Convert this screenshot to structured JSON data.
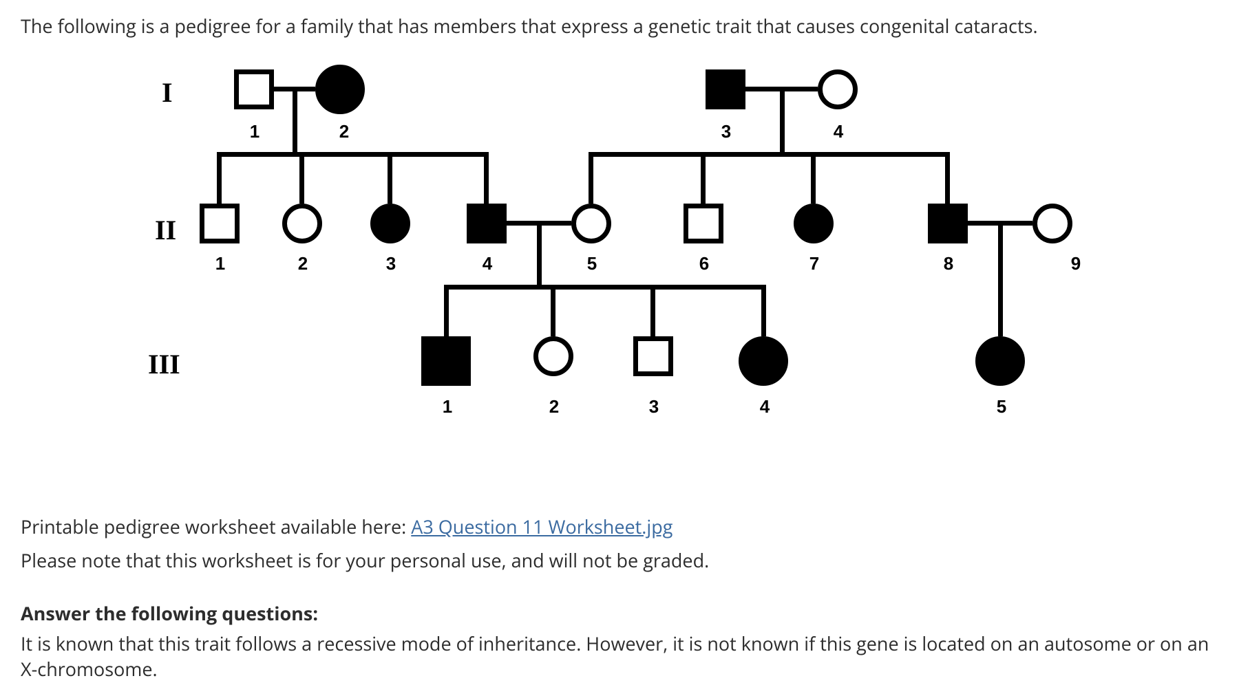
{
  "intro": "The following is a pedigree for a family that has members that express a genetic trait that causes congenital cataracts.",
  "generations": {
    "g1_label": "I",
    "g2_label": "II",
    "g3_label": "III"
  },
  "numbers": {
    "n1": "1",
    "n2": "2",
    "n3": "3",
    "n4": "4",
    "n5": "5",
    "n6": "6",
    "n7": "7",
    "n8": "8",
    "n9": "9"
  },
  "footer": {
    "printable_prefix": "Printable pedigree worksheet available here: ",
    "link_text": "A3 Question 11 Worksheet.jpg",
    "note": "Please note that this worksheet is for your personal use, and will not be graded.",
    "heading": "Answer the following questions:",
    "body": "It is known that this trait follows a recessive mode of inheritance. However, it is not known if this gene is located on an autosome or on an X-chromosome."
  },
  "pedigree": {
    "gen1": [
      {
        "id": "I-1",
        "sex": "male",
        "affected": false
      },
      {
        "id": "I-2",
        "sex": "female",
        "affected": true
      },
      {
        "id": "I-3",
        "sex": "male",
        "affected": true
      },
      {
        "id": "I-4",
        "sex": "female",
        "affected": false
      }
    ],
    "gen2": [
      {
        "id": "II-1",
        "sex": "male",
        "affected": false
      },
      {
        "id": "II-2",
        "sex": "female",
        "affected": false
      },
      {
        "id": "II-3",
        "sex": "female",
        "affected": true
      },
      {
        "id": "II-4",
        "sex": "male",
        "affected": true
      },
      {
        "id": "II-5",
        "sex": "female",
        "affected": false
      },
      {
        "id": "II-6",
        "sex": "male",
        "affected": false
      },
      {
        "id": "II-7",
        "sex": "female",
        "affected": true
      },
      {
        "id": "II-8",
        "sex": "male",
        "affected": true
      },
      {
        "id": "II-9",
        "sex": "female",
        "affected": false
      }
    ],
    "gen3": [
      {
        "id": "III-1",
        "sex": "male",
        "affected": true
      },
      {
        "id": "III-2",
        "sex": "female",
        "affected": false
      },
      {
        "id": "III-3",
        "sex": "male",
        "affected": false
      },
      {
        "id": "III-4",
        "sex": "female",
        "affected": true
      },
      {
        "id": "III-5",
        "sex": "female",
        "affected": true
      }
    ],
    "matings": [
      [
        "I-1",
        "I-2"
      ],
      [
        "I-3",
        "I-4"
      ],
      [
        "II-4",
        "II-5"
      ],
      [
        "II-8",
        "II-9"
      ]
    ],
    "parent_child": {
      "I-1xI-2": [
        "II-1",
        "II-2",
        "II-3",
        "II-4"
      ],
      "I-3xI-4": [
        "II-5",
        "II-6",
        "II-7",
        "II-8"
      ],
      "II-4xII-5": [
        "III-1",
        "III-2",
        "III-3",
        "III-4"
      ],
      "II-8xII-9": [
        "III-5"
      ]
    }
  }
}
